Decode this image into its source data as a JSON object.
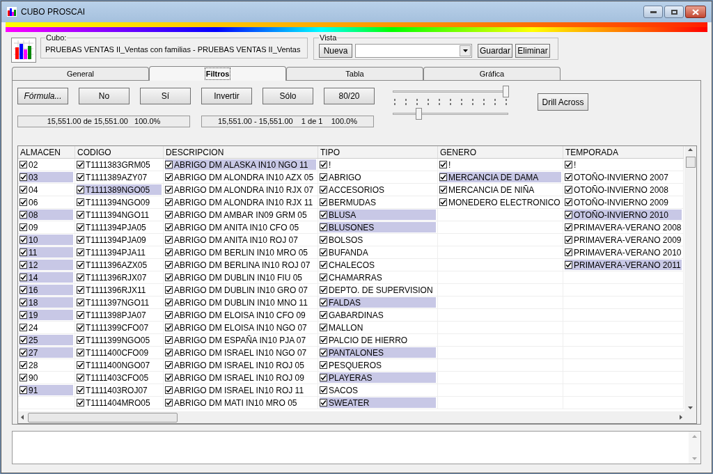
{
  "window": {
    "title": "CUBO PROSCAI"
  },
  "cube": {
    "label": "Cubo:",
    "name": "PRUEBAS VENTAS II_Ventas con familias - PRUEBAS VENTAS II_Ventas"
  },
  "view": {
    "label": "Vista",
    "new_button": "Nueva",
    "save_button": "Guardar",
    "delete_button": "Eliminar"
  },
  "tabs": [
    {
      "label": "General",
      "selected": false
    },
    {
      "label": "Filtros",
      "selected": true
    },
    {
      "label": "Tabla",
      "selected": false
    },
    {
      "label": "Gráfica",
      "selected": false
    }
  ],
  "filter_buttons": [
    {
      "label": "Fórmula...",
      "italic": true
    },
    {
      "label": "No",
      "italic": false
    },
    {
      "label": "Sí",
      "italic": false
    },
    {
      "label": "Invertir",
      "italic": false
    },
    {
      "label": "Sólo",
      "italic": false
    },
    {
      "label": "80/20",
      "italic": false
    }
  ],
  "status": [
    "15,551.00 de 15,551.00   100.0%",
    "15,551.00 - 15,551.00    1 de 1    100.0%"
  ],
  "sliders": [
    {
      "level": 1.0
    },
    {
      "level": 0.22
    }
  ],
  "drill_button": "Drill Across",
  "table": {
    "columns": [
      {
        "header": "ALMACEN",
        "items": [
          {
            "text": "02",
            "checked": true,
            "selected": false
          },
          {
            "text": "03",
            "checked": true,
            "selected": true
          },
          {
            "text": "04",
            "checked": true,
            "selected": false
          },
          {
            "text": "06",
            "checked": true,
            "selected": false
          },
          {
            "text": "08",
            "checked": true,
            "selected": true
          },
          {
            "text": "09",
            "checked": true,
            "selected": false
          },
          {
            "text": "10",
            "checked": true,
            "selected": true
          },
          {
            "text": "11",
            "checked": true,
            "selected": true
          },
          {
            "text": "12",
            "checked": true,
            "selected": true
          },
          {
            "text": "14",
            "checked": true,
            "selected": true
          },
          {
            "text": "16",
            "checked": true,
            "selected": true
          },
          {
            "text": "18",
            "checked": true,
            "selected": true
          },
          {
            "text": "19",
            "checked": true,
            "selected": true
          },
          {
            "text": "24",
            "checked": true,
            "selected": false
          },
          {
            "text": "25",
            "checked": true,
            "selected": true
          },
          {
            "text": "27",
            "checked": true,
            "selected": true
          },
          {
            "text": "28",
            "checked": true,
            "selected": false
          },
          {
            "text": "90",
            "checked": true,
            "selected": false
          },
          {
            "text": "91",
            "checked": true,
            "selected": true
          }
        ]
      },
      {
        "header": "CODIGO",
        "items": [
          {
            "text": "T1111383GRM05",
            "checked": true,
            "selected": false
          },
          {
            "text": "T1111389AZY07",
            "checked": true,
            "selected": false
          },
          {
            "text": "T1111389NGO05",
            "checked": true,
            "selected": true
          },
          {
            "text": "T1111394NGO09",
            "checked": true,
            "selected": false
          },
          {
            "text": "T1111394NGO11",
            "checked": true,
            "selected": false
          },
          {
            "text": "T1111394PJA05",
            "checked": true,
            "selected": false
          },
          {
            "text": "T1111394PJA09",
            "checked": true,
            "selected": false
          },
          {
            "text": "T1111394PJA11",
            "checked": true,
            "selected": false
          },
          {
            "text": "T1111396AZX05",
            "checked": true,
            "selected": false
          },
          {
            "text": "T1111396RJX07",
            "checked": true,
            "selected": false
          },
          {
            "text": "T1111396RJX11",
            "checked": true,
            "selected": false
          },
          {
            "text": "T1111397NGO11",
            "checked": true,
            "selected": false
          },
          {
            "text": "T1111398PJA07",
            "checked": true,
            "selected": false
          },
          {
            "text": "T1111399CFO07",
            "checked": true,
            "selected": false
          },
          {
            "text": "T1111399NGO05",
            "checked": true,
            "selected": false
          },
          {
            "text": "T1111400CFO09",
            "checked": true,
            "selected": false
          },
          {
            "text": "T1111400NGO07",
            "checked": true,
            "selected": false
          },
          {
            "text": "T1111403CFO05",
            "checked": true,
            "selected": false
          },
          {
            "text": "T1111403ROJ07",
            "checked": true,
            "selected": false
          },
          {
            "text": "T1111404MRO05",
            "checked": true,
            "selected": false
          }
        ]
      },
      {
        "header": "DESCRIPCION",
        "items": [
          {
            "text": "ABRIGO DM ALASKA IN10 NGO 11",
            "checked": true,
            "selected": true
          },
          {
            "text": "ABRIGO DM ALONDRA IN10 AZX 05",
            "checked": true,
            "selected": false
          },
          {
            "text": "ABRIGO DM ALONDRA IN10 RJX 07",
            "checked": true,
            "selected": false
          },
          {
            "text": "ABRIGO DM ALONDRA IN10 RJX 11",
            "checked": true,
            "selected": false
          },
          {
            "text": "ABRIGO DM AMBAR IN09 GRM 05",
            "checked": true,
            "selected": false
          },
          {
            "text": "ABRIGO DM ANITA IN10 CFO 05",
            "checked": true,
            "selected": false
          },
          {
            "text": "ABRIGO DM ANITA IN10 ROJ 07",
            "checked": true,
            "selected": false
          },
          {
            "text": "ABRIGO DM BERLIN IN10 MRO 05",
            "checked": true,
            "selected": false
          },
          {
            "text": "ABRIGO DM BERLINA IN10 ROJ 07",
            "checked": true,
            "selected": false
          },
          {
            "text": "ABRIGO DM DUBLIN IN10 FIU 05",
            "checked": true,
            "selected": false
          },
          {
            "text": "ABRIGO DM DUBLIN IN10 GRO 07",
            "checked": true,
            "selected": false
          },
          {
            "text": "ABRIGO DM DUBLIN IN10 MNO 11",
            "checked": true,
            "selected": false
          },
          {
            "text": "ABRIGO DM ELOISA IN10 CFO 09",
            "checked": true,
            "selected": false
          },
          {
            "text": "ABRIGO DM ELOISA IN10 NGO 07",
            "checked": true,
            "selected": false
          },
          {
            "text": "ABRIGO DM ESPAÑA IN10 PJA 07",
            "checked": true,
            "selected": false
          },
          {
            "text": "ABRIGO DM ISRAEL IN10 NGO 07",
            "checked": true,
            "selected": false
          },
          {
            "text": "ABRIGO DM ISRAEL IN10 ROJ 05",
            "checked": true,
            "selected": false
          },
          {
            "text": "ABRIGO DM ISRAEL IN10 ROJ 09",
            "checked": true,
            "selected": false
          },
          {
            "text": "ABRIGO DM ISRAEL IN10 ROJ 11",
            "checked": true,
            "selected": false
          },
          {
            "text": "ABRIGO DM MATI IN10 MRO 05",
            "checked": true,
            "selected": false
          }
        ]
      },
      {
        "header": "TIPO",
        "items": [
          {
            "text": "!",
            "checked": true,
            "selected": false
          },
          {
            "text": "ABRIGO",
            "checked": true,
            "selected": false
          },
          {
            "text": "ACCESORIOS",
            "checked": true,
            "selected": false
          },
          {
            "text": "BERMUDAS",
            "checked": true,
            "selected": false
          },
          {
            "text": "BLUSA",
            "checked": true,
            "selected": true
          },
          {
            "text": "BLUSONES",
            "checked": true,
            "selected": true
          },
          {
            "text": "BOLSOS",
            "checked": true,
            "selected": false
          },
          {
            "text": "BUFANDA",
            "checked": true,
            "selected": false
          },
          {
            "text": "CHALECOS",
            "checked": true,
            "selected": false
          },
          {
            "text": "CHAMARRAS",
            "checked": true,
            "selected": false
          },
          {
            "text": "DEPTO. DE SUPERVISION",
            "checked": true,
            "selected": false
          },
          {
            "text": "FALDAS",
            "checked": true,
            "selected": true
          },
          {
            "text": "GABARDINAS",
            "checked": true,
            "selected": false
          },
          {
            "text": "MALLON",
            "checked": true,
            "selected": false
          },
          {
            "text": "PALCIO DE HIERRO",
            "checked": true,
            "selected": false
          },
          {
            "text": "PANTALONES",
            "checked": true,
            "selected": true
          },
          {
            "text": "PESQUEROS",
            "checked": true,
            "selected": false
          },
          {
            "text": "PLAYERAS",
            "checked": true,
            "selected": true
          },
          {
            "text": "SACOS",
            "checked": true,
            "selected": false
          },
          {
            "text": "SWEATER",
            "checked": true,
            "selected": true
          }
        ]
      },
      {
        "header": "GENERO",
        "items": [
          {
            "text": "!",
            "checked": true,
            "selected": false
          },
          {
            "text": "MERCANCIA DE DAMA",
            "checked": true,
            "selected": true
          },
          {
            "text": "MERCANCIA DE NIÑA",
            "checked": true,
            "selected": false
          },
          {
            "text": "MONEDERO ELECTRONICO",
            "checked": true,
            "selected": false
          }
        ]
      },
      {
        "header": "TEMPORADA",
        "items": [
          {
            "text": "!",
            "checked": true,
            "selected": false
          },
          {
            "text": "OTOÑO-INVIERNO 2007",
            "checked": true,
            "selected": false
          },
          {
            "text": "OTOÑO-INVIERNO 2008",
            "checked": true,
            "selected": false
          },
          {
            "text": "OTOÑO-INVIERNO 2009",
            "checked": true,
            "selected": false
          },
          {
            "text": "OTOÑO-INVIERNO 2010",
            "checked": true,
            "selected": true
          },
          {
            "text": "PRIMAVERA-VERANO 2008",
            "checked": true,
            "selected": false
          },
          {
            "text": "PRIMAVERA-VERANO 2009",
            "checked": true,
            "selected": false
          },
          {
            "text": "PRIMAVERA-VERANO 2010",
            "checked": true,
            "selected": false
          },
          {
            "text": "PRIMAVERA-VERANO 2011",
            "checked": true,
            "selected": true
          }
        ]
      }
    ]
  }
}
